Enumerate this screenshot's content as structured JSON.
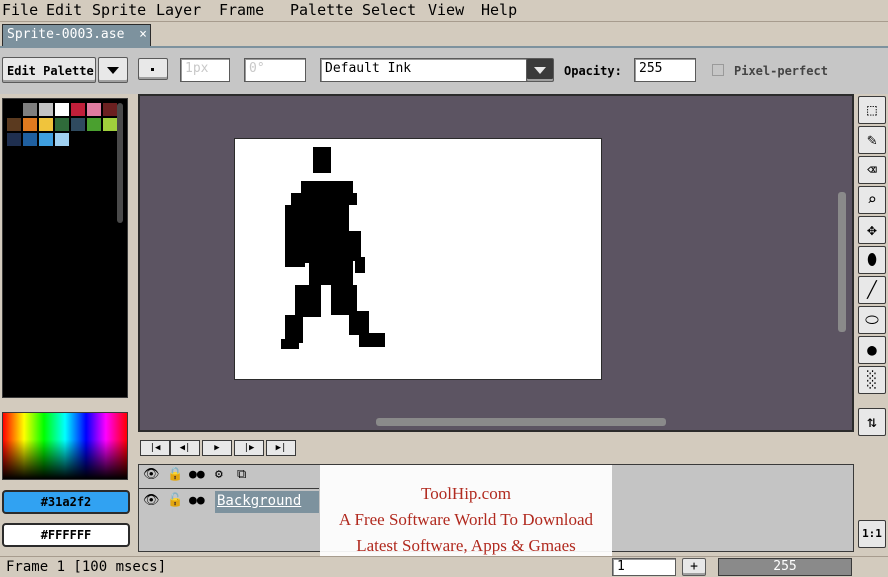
{
  "menu": [
    "File",
    "Edit",
    "Sprite",
    "Layer",
    "Frame",
    "Palette",
    "Select",
    "View",
    "Help"
  ],
  "tab": {
    "title": "Sprite-0003.ase",
    "close": "×"
  },
  "toolbar": {
    "edit_palette_label": "Edit Palette",
    "brush_size": "1px",
    "brush_angle": "0°",
    "ink": "Default Ink",
    "opacity_label": "Opacity:",
    "opacity_value": "255",
    "pixel_perfect_label": "Pixel-perfect"
  },
  "palette": {
    "swatches": [
      "#000000",
      "#7f7f7f",
      "#c3c3c3",
      "#ffffff",
      "#c01f3a",
      "#e07ca0",
      "#6b2020",
      "#5b3a1f",
      "#e07a1f",
      "#f0c43c",
      "#2f6b3a",
      "#2f4a5f",
      "#4aa02f",
      "#a0d03c",
      "#1f2f4f",
      "#1f5f9f",
      "#3f9fdf",
      "#9fd0f0"
    ]
  },
  "colors": {
    "foreground": "#31a2f2",
    "background": "#FFFFFF",
    "canvas_bg": "#5c5462"
  },
  "timeline": {
    "layer_name": "Background",
    "frame_number": "1",
    "frame_value": "255"
  },
  "status": {
    "text": "Frame 1 [100 msecs]"
  },
  "zoom_button": "1:1",
  "right_tool_icons": [
    "marquee-icon",
    "pencil-icon",
    "eraser-icon",
    "zoom-icon",
    "move-icon",
    "paint-bucket-icon",
    "line-icon",
    "ellipse-icon",
    "contour-icon",
    "spray-icon"
  ],
  "watermark": {
    "line1": "ToolHip.com",
    "line2": "A Free Software World To Download",
    "line3": "Latest Software, Apps & Gmaes"
  }
}
